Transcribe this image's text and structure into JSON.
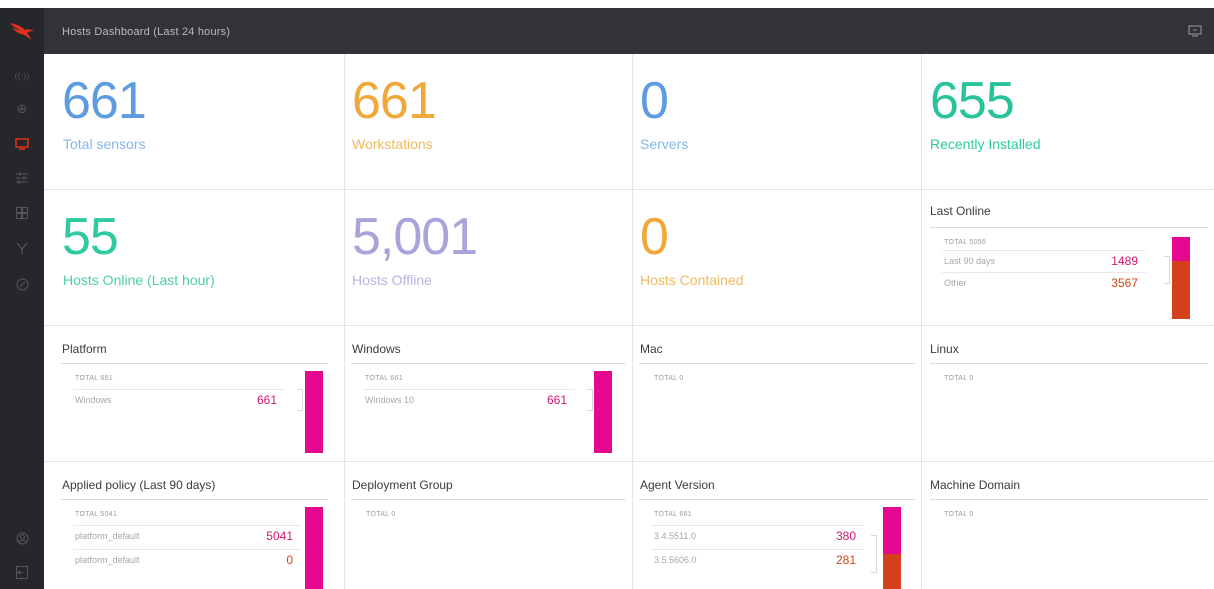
{
  "app": {
    "header_title": "Hosts Dashboard (Last 24 hours)"
  },
  "sidebar": {
    "items": [
      {
        "icon": "activity-icon",
        "glyph": "((·))"
      },
      {
        "icon": "search-icon",
        "glyph": "⊕"
      },
      {
        "icon": "hosts-icon",
        "glyph": "▭",
        "active": true
      },
      {
        "icon": "configuration-icon",
        "glyph": "☷"
      },
      {
        "icon": "dashboards-icon",
        "glyph": "▦"
      },
      {
        "icon": "investigate-icon",
        "glyph": "Y"
      },
      {
        "icon": "intelligence-icon",
        "glyph": "⊘"
      }
    ],
    "bottom": [
      {
        "icon": "user-icon",
        "glyph": "☺"
      },
      {
        "icon": "logout-icon",
        "glyph": "⇤"
      }
    ]
  },
  "stats": {
    "total_sensors": {
      "value": "661",
      "label": "Total sensors",
      "color": "#5d9ce0",
      "label_color": "#86b6ea"
    },
    "workstations": {
      "value": "661",
      "label": "Workstations",
      "color": "#f0a83a",
      "label_color": "#f2b95f"
    },
    "servers": {
      "value": "0",
      "label": "Servers",
      "color": "#5d9ce0",
      "label_color": "#86b6ea"
    },
    "recently_installed": {
      "value": "655",
      "label": "Recently Installed",
      "color": "#27c39a",
      "label_color": "#2fcaa0"
    },
    "hosts_online": {
      "value": "55",
      "label": "Hosts Online (Last hour)",
      "color": "#2fcaa0",
      "label_color": "#4bcfa8"
    },
    "hosts_offline": {
      "value": "5,001",
      "label": "Hosts Offline",
      "color": "#a7a4dc",
      "label_color": "#b6b3e2"
    },
    "hosts_contained": {
      "value": "0",
      "label": "Hosts Contained",
      "color": "#f0a83a",
      "label_color": "#f2b95f"
    }
  },
  "charts": {
    "last_online": {
      "title": "Last Online",
      "total": "TOTAL 5056",
      "rows": [
        {
          "label": "Last 90 days",
          "value": "1489"
        },
        {
          "label": "Other",
          "value": "3567"
        }
      ]
    },
    "platform": {
      "title": "Platform",
      "total": "TOTAL 661",
      "rows": [
        {
          "label": "Windows",
          "value": "661"
        }
      ]
    },
    "windows": {
      "title": "Windows",
      "total": "TOTAL 661",
      "rows": [
        {
          "label": "Windows 10",
          "value": "661"
        }
      ]
    },
    "mac": {
      "title": "Mac",
      "total": "TOTAL 0"
    },
    "linux": {
      "title": "Linux",
      "total": "TOTAL 0"
    },
    "applied_policy": {
      "title": "Applied policy (Last 90 days)",
      "total": "TOTAL 5041",
      "rows": [
        {
          "label": "platform_default",
          "value": "5041"
        },
        {
          "label": "platform_default",
          "value": "0"
        }
      ]
    },
    "deployment_group": {
      "title": "Deployment Group",
      "total": "TOTAL 0"
    },
    "agent_version": {
      "title": "Agent Version",
      "total": "TOTAL 661",
      "rows": [
        {
          "label": "3.4.5511.0",
          "value": "380"
        },
        {
          "label": "3.5.5606.0",
          "value": "281"
        }
      ]
    },
    "machine_domain": {
      "title": "Machine Domain",
      "total": "TOTAL 0"
    }
  },
  "colors": {
    "magenta": "#e6088e",
    "orange_red": "#d63f1c",
    "header_bg": "#323337",
    "sidebar_bg": "#26272a"
  },
  "chart_data": [
    {
      "type": "bar",
      "title": "Last Online",
      "categories": [
        "Last 90 days",
        "Other"
      ],
      "values": [
        1489,
        3567
      ],
      "stacked": true
    },
    {
      "type": "bar",
      "title": "Platform",
      "categories": [
        "Windows"
      ],
      "values": [
        661
      ],
      "stacked": true
    },
    {
      "type": "bar",
      "title": "Windows",
      "categories": [
        "Windows 10"
      ],
      "values": [
        661
      ],
      "stacked": true
    },
    {
      "type": "bar",
      "title": "Applied policy (Last 90 days)",
      "categories": [
        "platform_default",
        "platform_default"
      ],
      "values": [
        5041,
        0
      ],
      "stacked": true
    },
    {
      "type": "bar",
      "title": "Agent Version",
      "categories": [
        "3.4.5511.0",
        "3.5.5606.0"
      ],
      "values": [
        380,
        281
      ],
      "stacked": true
    }
  ]
}
